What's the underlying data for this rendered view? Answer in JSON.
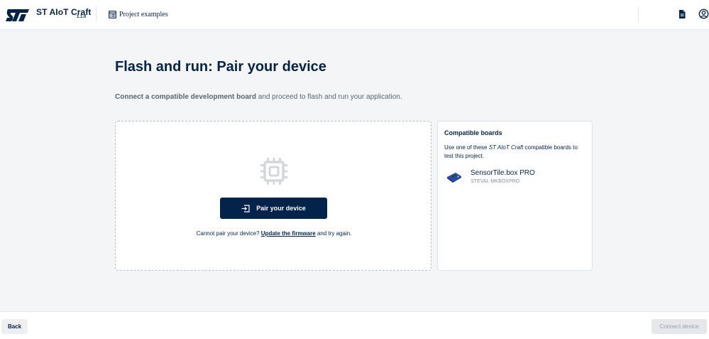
{
  "header": {
    "brand_name": "ST AIoT Craft",
    "version": "1.1.0",
    "nav_projects_label": "Project examples",
    "icons": [
      "st-logo-icon",
      "project-list-icon",
      "document-icon",
      "user-account-icon"
    ]
  },
  "page": {
    "title_prefix": "Flash and run: ",
    "title_strong": "Pair your device",
    "subtitle_strong": "Connect a compatible development board",
    "subtitle_rest": " and proceed to flash and run your application."
  },
  "pair": {
    "button_label": "Pair your device",
    "help_prefix": "Cannot pair your device? ",
    "help_link": "Update the firmware",
    "help_suffix": " and try again.",
    "icons": [
      "chip-icon",
      "pair-login-icon"
    ]
  },
  "boards": {
    "title": "Compatible boards",
    "desc_prefix": "Use one of these ",
    "desc_em": "ST AIoT Craft",
    "desc_suffix": " compatible boards to test this project.",
    "items": [
      {
        "name": "SensorTile.box PRO",
        "code": "STEVAL-MKBOXPRO"
      }
    ]
  },
  "footer": {
    "back_label": "Back",
    "connect_label": "Connect device"
  },
  "colors": {
    "primary": "#03234b",
    "background": "#f4f5f6",
    "disabled_bg": "#e5e7ea",
    "disabled_text": "#9aa1a9",
    "chip_icon": "#d4d7db"
  }
}
